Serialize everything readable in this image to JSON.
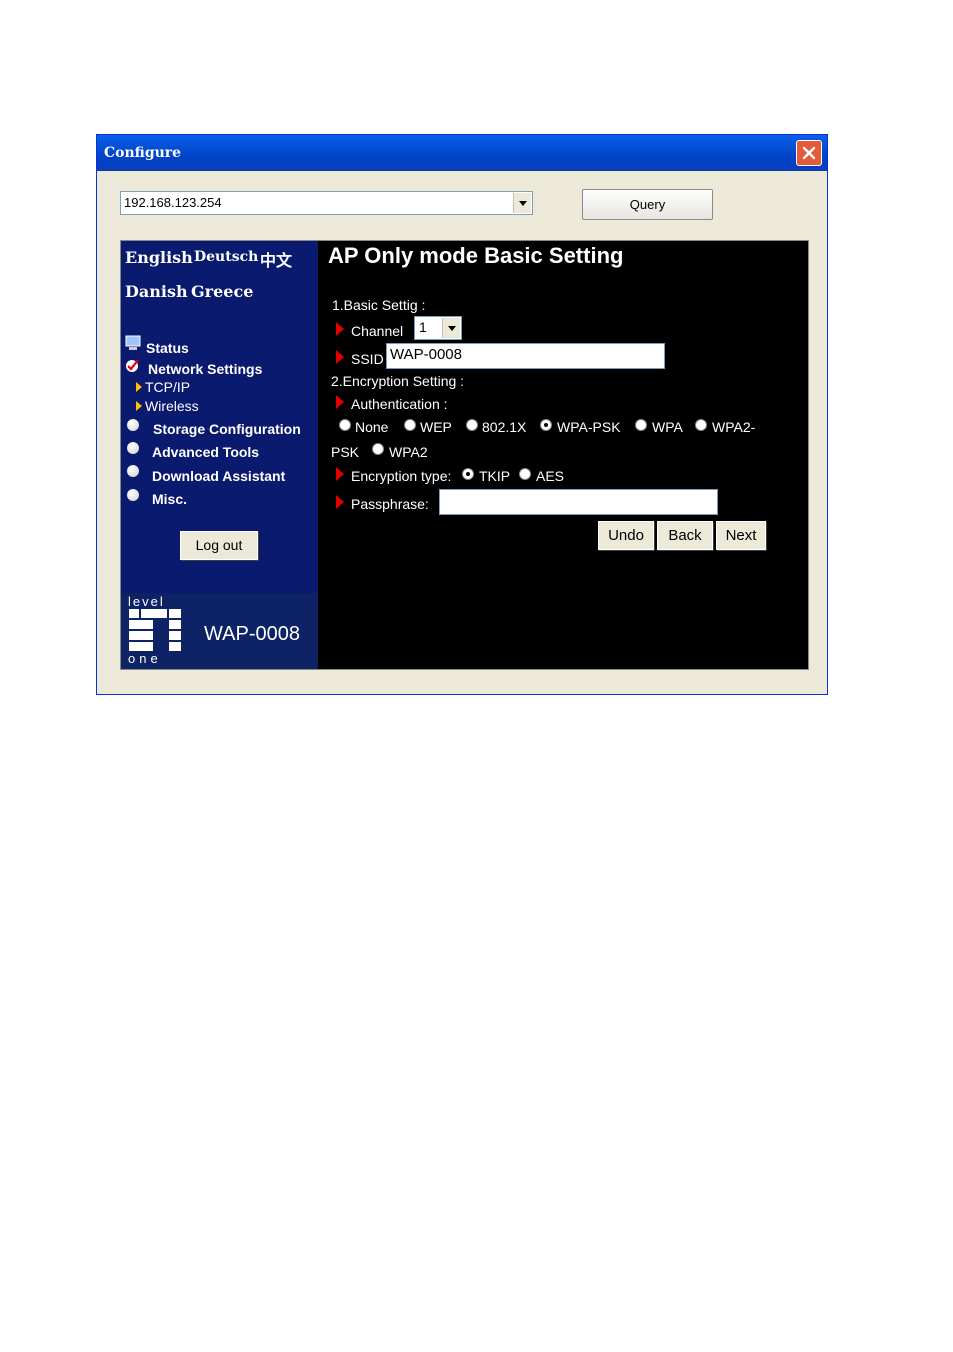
{
  "window": {
    "title": "Configure"
  },
  "toolbar": {
    "address": "192.168.123.254",
    "query_label": "Query"
  },
  "sidebar": {
    "languages": [
      "English",
      "Deutsch",
      "中文",
      "Danish",
      "Greece"
    ],
    "items": [
      {
        "label": "Status"
      },
      {
        "label": "Network Settings"
      },
      {
        "label": "TCP/IP"
      },
      {
        "label": "Wireless"
      },
      {
        "label": "Storage Configuration"
      },
      {
        "label": "Advanced Tools"
      },
      {
        "label": "Download Assistant"
      },
      {
        "label": "Misc."
      }
    ],
    "logout_label": "Log out",
    "logo_top": "level",
    "logo_bottom": "one",
    "model": "WAP-0008"
  },
  "main": {
    "heading": "AP Only mode Basic Setting",
    "basic_section": "1.Basic Settig :",
    "channel_label": "Channel",
    "channel_value": "1",
    "ssid_label": "SSID",
    "ssid_value": "WAP-0008",
    "enc_section": "2.Encryption Setting :",
    "auth_label": "Authentication :",
    "auth_options": [
      "None",
      "WEP",
      "802.1X",
      "WPA-PSK",
      "WPA",
      "WPA2-",
      "PSK",
      "WPA2"
    ],
    "auth_selected": "WPA-PSK",
    "enc_type_label": "Encryption type:",
    "enc_options": [
      "TKIP",
      "AES"
    ],
    "enc_selected": "TKIP",
    "passphrase_label": "Passphrase:",
    "passphrase_value": "",
    "buttons": {
      "undo": "Undo",
      "back": "Back",
      "next": "Next"
    }
  }
}
